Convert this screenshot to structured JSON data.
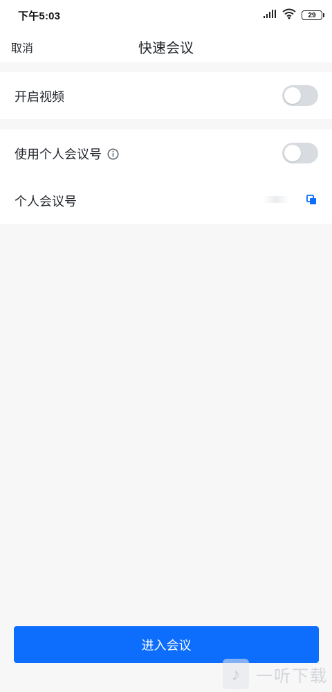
{
  "status_bar": {
    "time": "下午5:03",
    "battery_level": "29",
    "icons": [
      "signal-icon",
      "wifi-icon",
      "battery-icon"
    ]
  },
  "nav": {
    "cancel_label": "取消",
    "title": "快速会议"
  },
  "settings": {
    "video": {
      "label": "开启视频",
      "enabled": false
    },
    "personal_meeting_id": {
      "label": "使用个人会议号",
      "enabled": false,
      "info_icon": "info-icon"
    },
    "personal_id_row": {
      "label": "个人会议号",
      "copy_icon": "copy-icon"
    }
  },
  "actions": {
    "join_label": "进入会议"
  },
  "watermark": {
    "text": "一听下载"
  },
  "colors": {
    "accent": "#0d6efd",
    "toggle_off": "#d8dbe0",
    "background": "#f7f7f8"
  }
}
